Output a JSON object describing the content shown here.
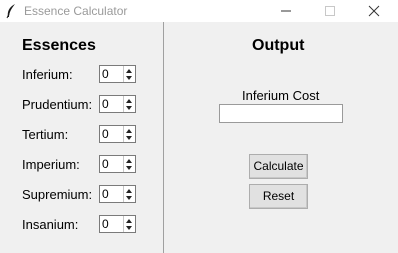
{
  "window": {
    "title": "Essence Calculator"
  },
  "left": {
    "heading": "Essences",
    "rows": [
      {
        "label": "Inferium:",
        "value": "0"
      },
      {
        "label": "Prudentium:",
        "value": "0"
      },
      {
        "label": "Tertium:",
        "value": "0"
      },
      {
        "label": "Imperium:",
        "value": "0"
      },
      {
        "label": "Supremium:",
        "value": "0"
      },
      {
        "label": "Insanium:",
        "value": "0"
      }
    ]
  },
  "right": {
    "heading": "Output",
    "output_label": "Inferium Cost",
    "output_value": "",
    "calculate_label": "Calculate",
    "reset_label": "Reset"
  }
}
